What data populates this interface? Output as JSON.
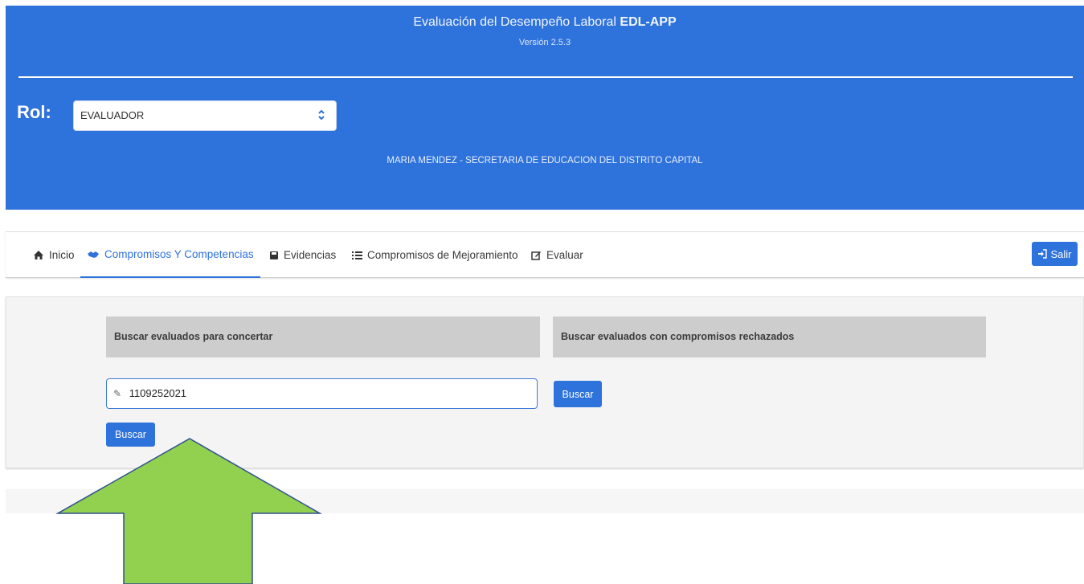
{
  "header": {
    "title_prefix": "Evaluación del Desempeño Laboral ",
    "title_app": "EDL-APP",
    "version": "Versión 2.5.3",
    "rol_label": "Rol:",
    "rol_value": "EVALUADOR",
    "user_line": "MARIA MENDEZ - SECRETARIA DE EDUCACION DEL DISTRITO CAPITAL"
  },
  "nav": {
    "items": [
      {
        "label": "Inicio",
        "icon": "home-icon"
      },
      {
        "label": "Compromisos Y Competencias",
        "icon": "handshake-icon",
        "active": true
      },
      {
        "label": "Evidencias",
        "icon": "save-icon"
      },
      {
        "label": "Compromisos de Mejoramiento",
        "icon": "list-icon"
      },
      {
        "label": "Evaluar",
        "icon": "edit-icon"
      }
    ],
    "logout_label": "Salir"
  },
  "search": {
    "left_heading": "Buscar evaluados para concertar",
    "right_heading": "Buscar evaluados con compromisos rechazados",
    "document_value": "1109252021",
    "left_button": "Buscar",
    "right_button": "Buscar"
  },
  "colors": {
    "primary": "#2e72db",
    "header_bg": "#2e72db",
    "panel_bg": "#f4f4f4",
    "heading_bg": "#cdcdcd",
    "arrow_fill": "#92d050",
    "arrow_stroke": "#2f4f8f"
  }
}
